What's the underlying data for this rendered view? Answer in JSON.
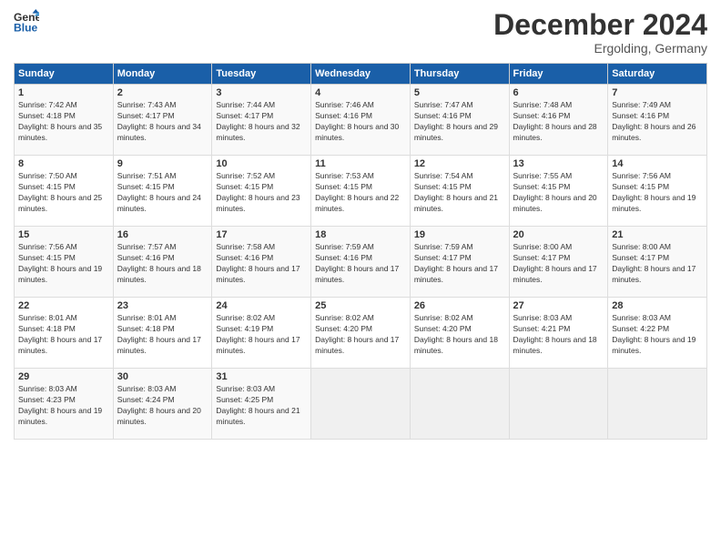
{
  "header": {
    "logo_line1": "General",
    "logo_line2": "Blue",
    "month": "December 2024",
    "location": "Ergolding, Germany"
  },
  "weekdays": [
    "Sunday",
    "Monday",
    "Tuesday",
    "Wednesday",
    "Thursday",
    "Friday",
    "Saturday"
  ],
  "weeks": [
    [
      {
        "day": "1",
        "sunrise": "7:42 AM",
        "sunset": "4:18 PM",
        "daylight": "8 hours and 35 minutes."
      },
      {
        "day": "2",
        "sunrise": "7:43 AM",
        "sunset": "4:17 PM",
        "daylight": "8 hours and 34 minutes."
      },
      {
        "day": "3",
        "sunrise": "7:44 AM",
        "sunset": "4:17 PM",
        "daylight": "8 hours and 32 minutes."
      },
      {
        "day": "4",
        "sunrise": "7:46 AM",
        "sunset": "4:16 PM",
        "daylight": "8 hours and 30 minutes."
      },
      {
        "day": "5",
        "sunrise": "7:47 AM",
        "sunset": "4:16 PM",
        "daylight": "8 hours and 29 minutes."
      },
      {
        "day": "6",
        "sunrise": "7:48 AM",
        "sunset": "4:16 PM",
        "daylight": "8 hours and 28 minutes."
      },
      {
        "day": "7",
        "sunrise": "7:49 AM",
        "sunset": "4:16 PM",
        "daylight": "8 hours and 26 minutes."
      }
    ],
    [
      {
        "day": "8",
        "sunrise": "7:50 AM",
        "sunset": "4:15 PM",
        "daylight": "8 hours and 25 minutes."
      },
      {
        "day": "9",
        "sunrise": "7:51 AM",
        "sunset": "4:15 PM",
        "daylight": "8 hours and 24 minutes."
      },
      {
        "day": "10",
        "sunrise": "7:52 AM",
        "sunset": "4:15 PM",
        "daylight": "8 hours and 23 minutes."
      },
      {
        "day": "11",
        "sunrise": "7:53 AM",
        "sunset": "4:15 PM",
        "daylight": "8 hours and 22 minutes."
      },
      {
        "day": "12",
        "sunrise": "7:54 AM",
        "sunset": "4:15 PM",
        "daylight": "8 hours and 21 minutes."
      },
      {
        "day": "13",
        "sunrise": "7:55 AM",
        "sunset": "4:15 PM",
        "daylight": "8 hours and 20 minutes."
      },
      {
        "day": "14",
        "sunrise": "7:56 AM",
        "sunset": "4:15 PM",
        "daylight": "8 hours and 19 minutes."
      }
    ],
    [
      {
        "day": "15",
        "sunrise": "7:56 AM",
        "sunset": "4:15 PM",
        "daylight": "8 hours and 19 minutes."
      },
      {
        "day": "16",
        "sunrise": "7:57 AM",
        "sunset": "4:16 PM",
        "daylight": "8 hours and 18 minutes."
      },
      {
        "day": "17",
        "sunrise": "7:58 AM",
        "sunset": "4:16 PM",
        "daylight": "8 hours and 17 minutes."
      },
      {
        "day": "18",
        "sunrise": "7:59 AM",
        "sunset": "4:16 PM",
        "daylight": "8 hours and 17 minutes."
      },
      {
        "day": "19",
        "sunrise": "7:59 AM",
        "sunset": "4:17 PM",
        "daylight": "8 hours and 17 minutes."
      },
      {
        "day": "20",
        "sunrise": "8:00 AM",
        "sunset": "4:17 PM",
        "daylight": "8 hours and 17 minutes."
      },
      {
        "day": "21",
        "sunrise": "8:00 AM",
        "sunset": "4:17 PM",
        "daylight": "8 hours and 17 minutes."
      }
    ],
    [
      {
        "day": "22",
        "sunrise": "8:01 AM",
        "sunset": "4:18 PM",
        "daylight": "8 hours and 17 minutes."
      },
      {
        "day": "23",
        "sunrise": "8:01 AM",
        "sunset": "4:18 PM",
        "daylight": "8 hours and 17 minutes."
      },
      {
        "day": "24",
        "sunrise": "8:02 AM",
        "sunset": "4:19 PM",
        "daylight": "8 hours and 17 minutes."
      },
      {
        "day": "25",
        "sunrise": "8:02 AM",
        "sunset": "4:20 PM",
        "daylight": "8 hours and 17 minutes."
      },
      {
        "day": "26",
        "sunrise": "8:02 AM",
        "sunset": "4:20 PM",
        "daylight": "8 hours and 18 minutes."
      },
      {
        "day": "27",
        "sunrise": "8:03 AM",
        "sunset": "4:21 PM",
        "daylight": "8 hours and 18 minutes."
      },
      {
        "day": "28",
        "sunrise": "8:03 AM",
        "sunset": "4:22 PM",
        "daylight": "8 hours and 19 minutes."
      }
    ],
    [
      {
        "day": "29",
        "sunrise": "8:03 AM",
        "sunset": "4:23 PM",
        "daylight": "8 hours and 19 minutes."
      },
      {
        "day": "30",
        "sunrise": "8:03 AM",
        "sunset": "4:24 PM",
        "daylight": "8 hours and 20 minutes."
      },
      {
        "day": "31",
        "sunrise": "8:03 AM",
        "sunset": "4:25 PM",
        "daylight": "8 hours and 21 minutes."
      },
      null,
      null,
      null,
      null
    ]
  ]
}
